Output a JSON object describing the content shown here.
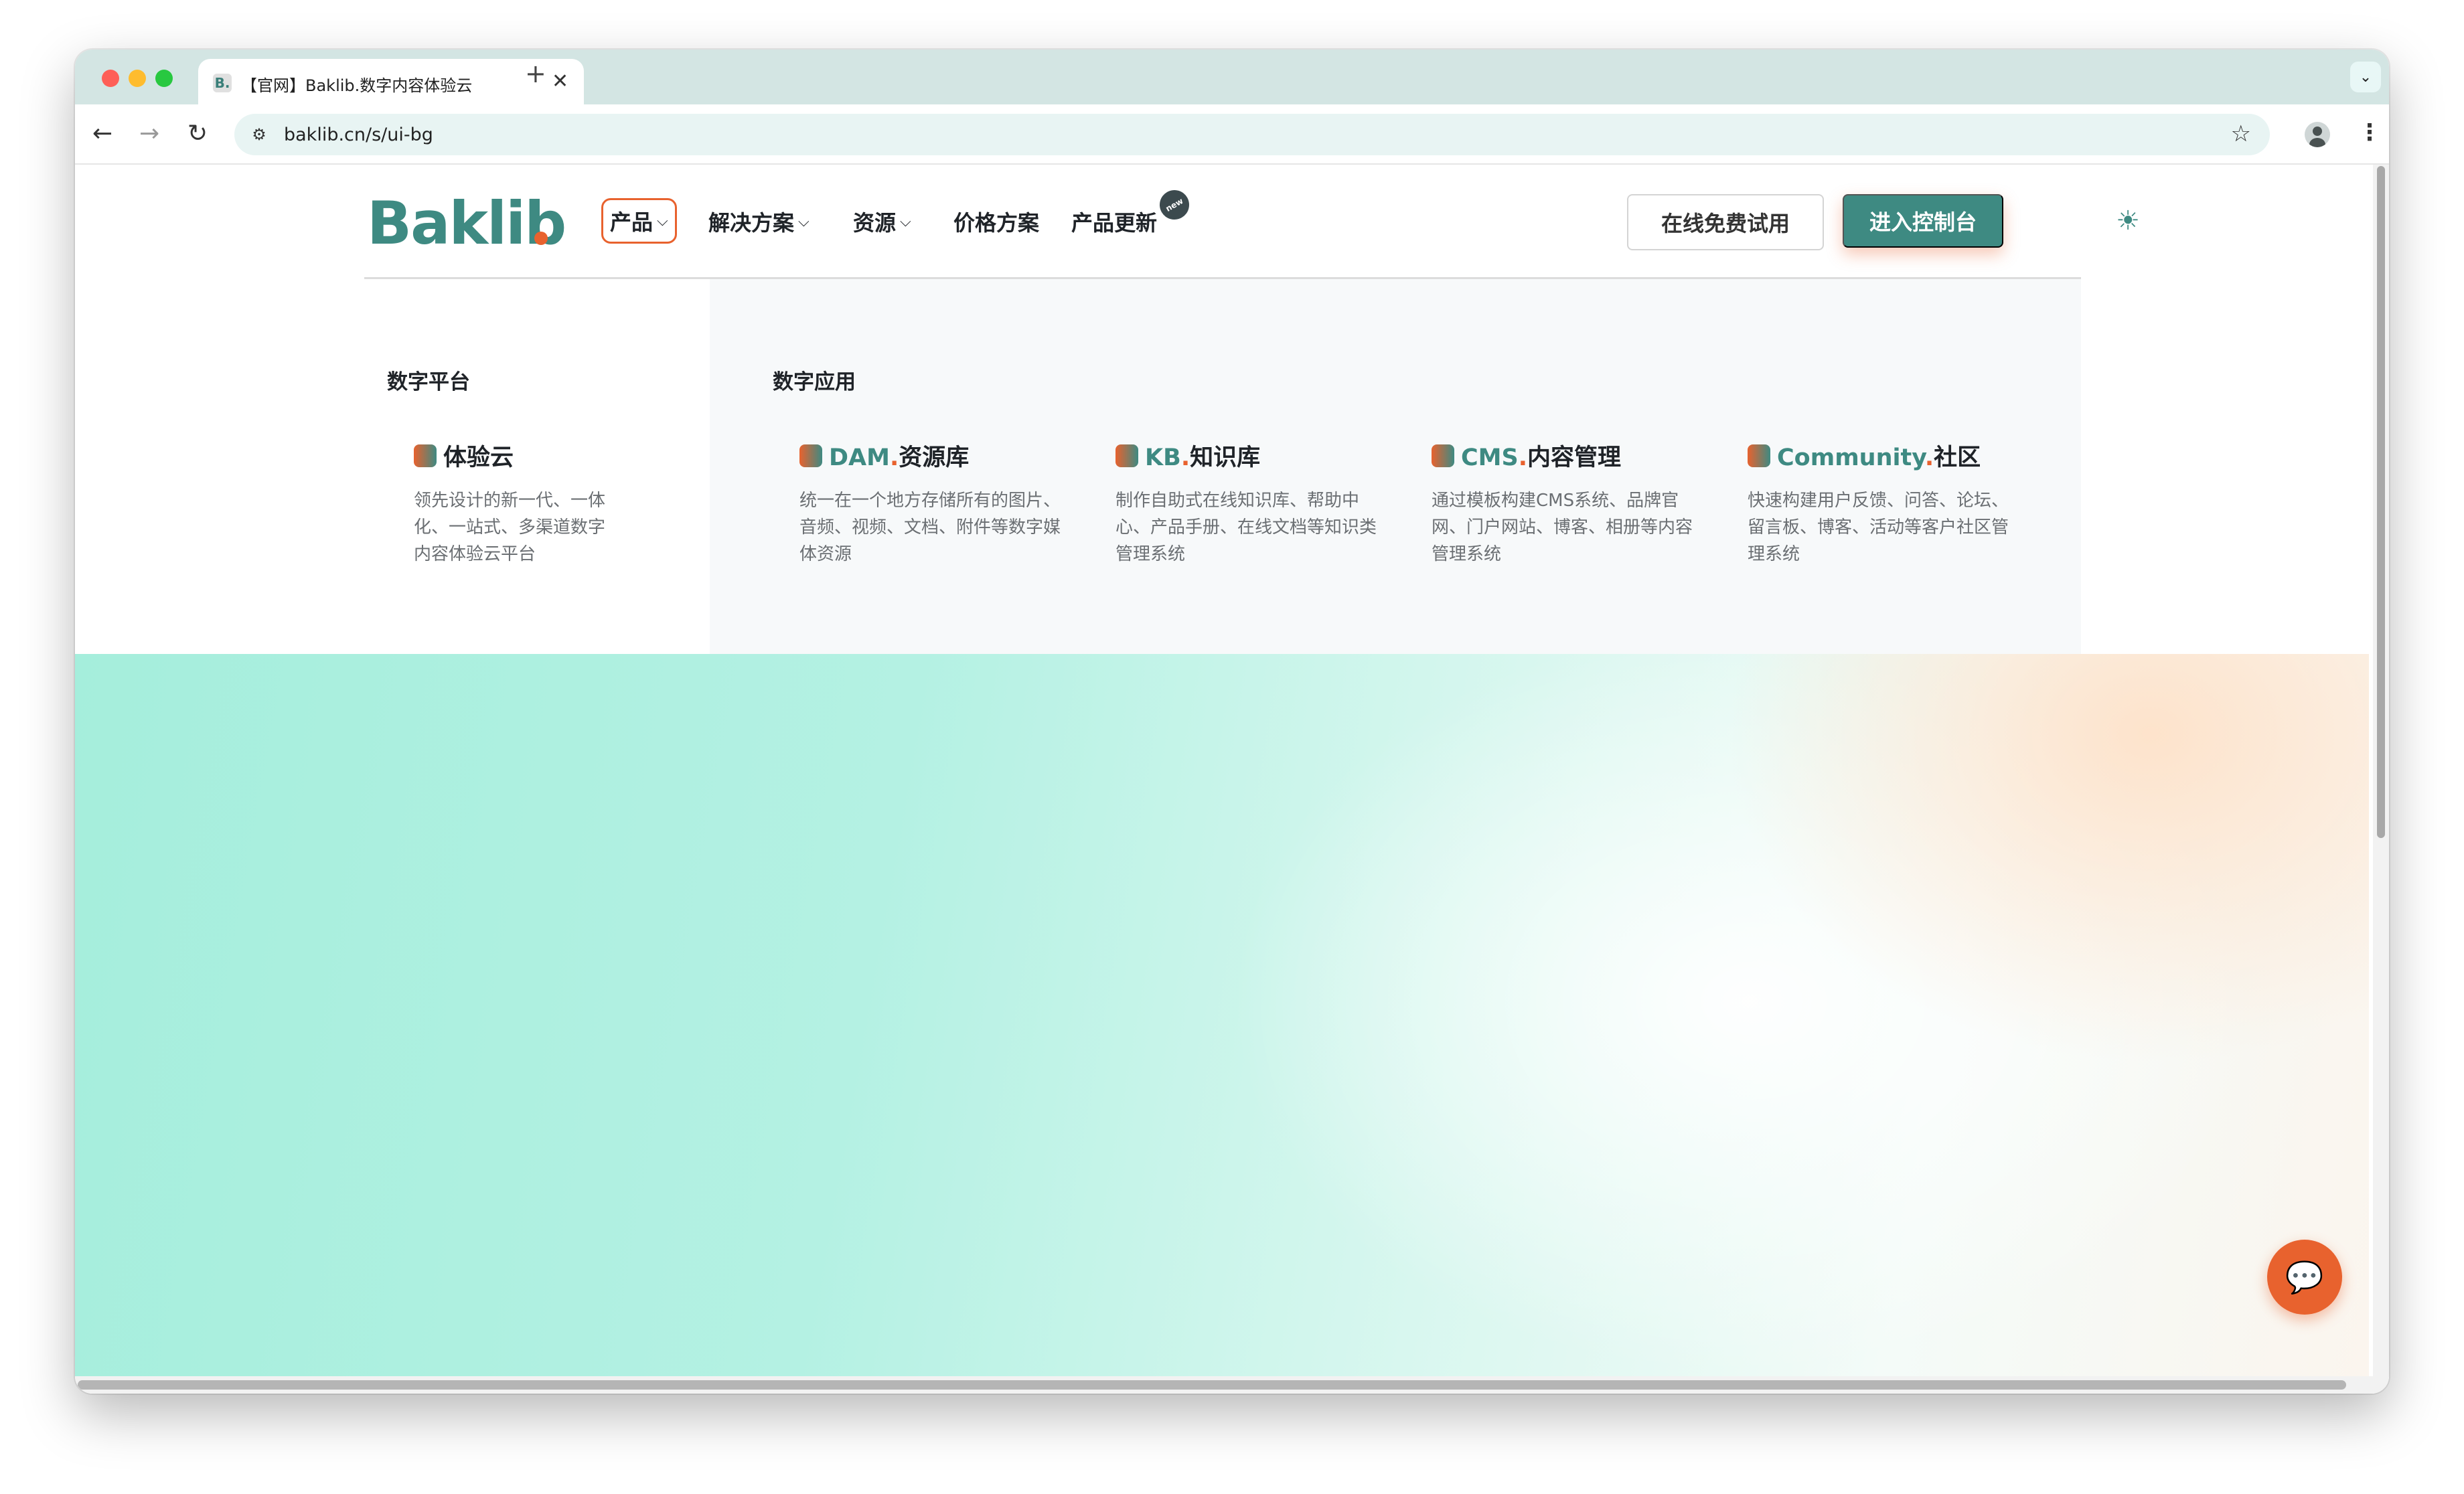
{
  "browser": {
    "tab": {
      "favicon": "B.",
      "title": "【官网】Baklib.数字内容体验云",
      "close_icon": "close-icon"
    },
    "new_tab_icon": "+",
    "url": "baklib.cn/s/ui-bg"
  },
  "site": {
    "logo": "Baklib",
    "nav": {
      "product": "产品",
      "solutions": "解决方案",
      "resources": "资源",
      "pricing": "价格方案",
      "updates": "产品更新",
      "new_badge": "new"
    },
    "buttons": {
      "trial": "在线免费试用",
      "console": "进入控制台"
    }
  },
  "mega_menu": {
    "platform": {
      "title": "数字平台",
      "items": [
        {
          "prefix": "",
          "name": "体验云",
          "desc": "领先设计的新一代、一体化、一站式、多渠道数字内容体验云平台"
        }
      ]
    },
    "apps": {
      "title": "数字应用",
      "items": [
        {
          "prefix": "DAM",
          "name": "资源库",
          "desc": "统一在一个地方存储所有的图片、音频、视频、文档、附件等数字媒体资源"
        },
        {
          "prefix": "KB",
          "name": "知识库",
          "desc": "制作自助式在线知识库、帮助中心、产品手册、在线文档等知识类管理系统"
        },
        {
          "prefix": "CMS",
          "name": "内容管理",
          "desc": "通过模板构建CMS系统、品牌官网、门户网站、博客、相册等内容管理系统"
        },
        {
          "prefix": "Community",
          "name": "社区",
          "desc": "快速构建用户反馈、问答、论坛、留言板、博客、活动等客户社区管理系统"
        }
      ]
    }
  },
  "colors": {
    "brand_teal": "#3e8a82",
    "brand_orange": "#e8622e"
  }
}
